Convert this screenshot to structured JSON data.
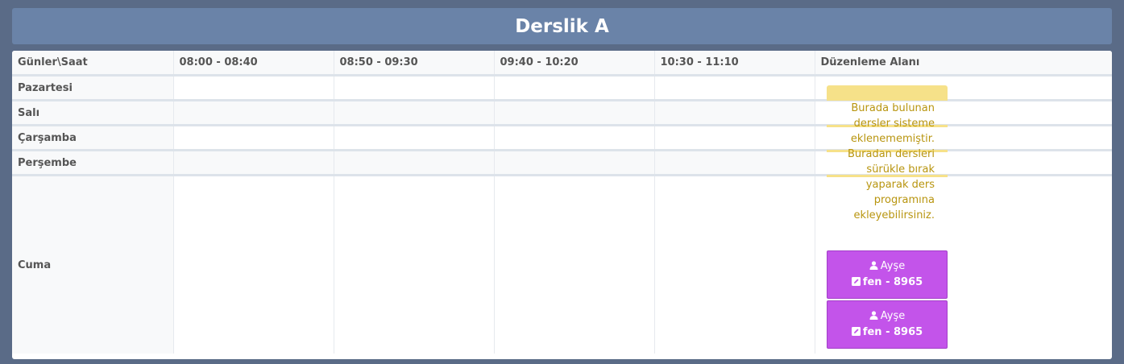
{
  "header": {
    "title": "Derslik A"
  },
  "table": {
    "corner_label": "Günler\\Saat",
    "slots": [
      "08:00 - 08:40",
      "08:50 - 09:30",
      "09:40 - 10:20",
      "10:30 - 11:10"
    ],
    "edit_area_label": "Düzenleme Alanı",
    "days": [
      "Pazartesi",
      "Salı",
      "Çarşamba",
      "Perşembe",
      "Cuma"
    ]
  },
  "edit_area": {
    "notice_lines": [
      "Burada bulunan",
      "dersler sisteme",
      "eklenememiştir.",
      "Buradan dersleri",
      "sürükle bırak",
      "yaparak ders",
      "programına",
      "ekleyebilirsiniz."
    ],
    "lessons": [
      {
        "teacher": "Ayşe",
        "course": "fen - 8965",
        "teacher_icon": "user-icon",
        "course_icon": "edit-icon"
      },
      {
        "teacher": "Ayşe",
        "course": "fen - 8965",
        "teacher_icon": "user-icon",
        "course_icon": "edit-icon"
      }
    ]
  },
  "colors": {
    "background": "#5a6b87",
    "title_bar": "#6a83a8",
    "notice_text": "#b8950f",
    "notice_band": "#f6e189",
    "lesson_card": "#c354ea"
  }
}
